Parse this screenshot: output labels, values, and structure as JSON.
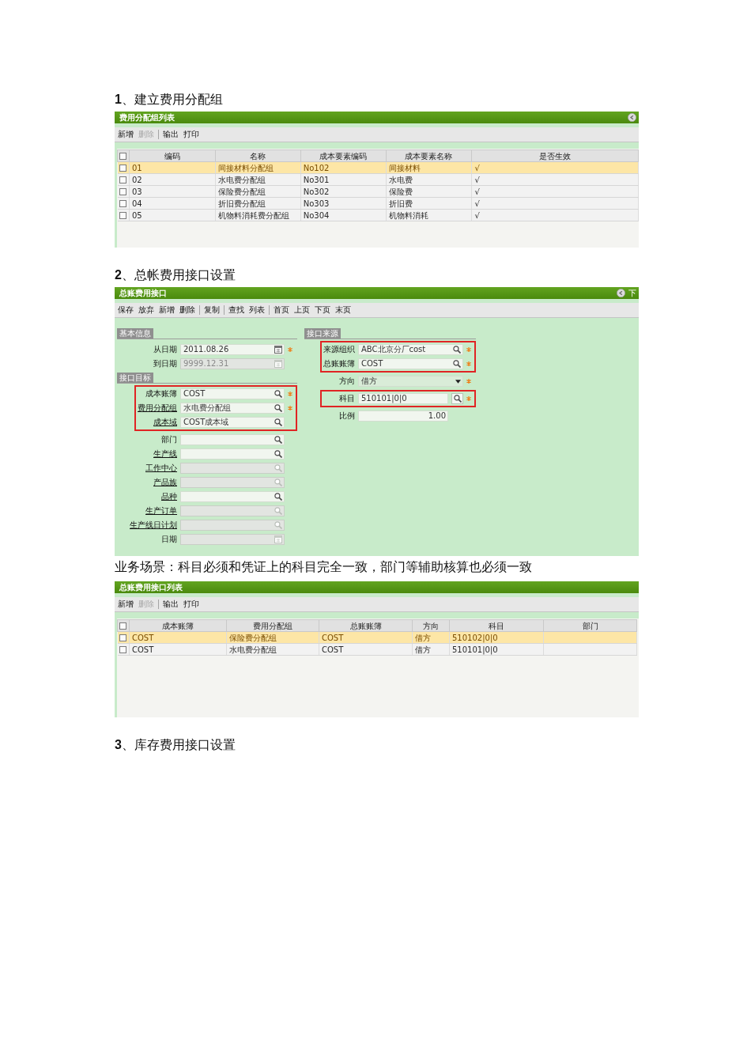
{
  "blocks": [
    {
      "kind": "heading",
      "text": "**1**、建立费用分配组"
    },
    {
      "kind": "list_panel",
      "title": "费用分配组列表",
      "collapsible": true,
      "toolbar": [
        [
          {
            "label": "新增",
            "disabled": false
          },
          {
            "label": "删除",
            "disabled": true
          }
        ],
        [
          {
            "label": "输出",
            "disabled": false
          },
          {
            "label": "打印",
            "disabled": false
          }
        ]
      ],
      "table": {
        "all_checked": false,
        "columns": [
          "编码",
          "名称",
          "成本要素编码",
          "成本要素名称",
          "是否生效"
        ],
        "rows": [
          {
            "selected": true,
            "checked": false,
            "cells": [
              "01",
              "间接材料分配组",
              "No102",
              "间接材料",
              "√"
            ]
          },
          {
            "selected": false,
            "checked": false,
            "cells": [
              "02",
              "水电费分配组",
              "No301",
              "水电费",
              "√"
            ]
          },
          {
            "selected": false,
            "checked": false,
            "cells": [
              "03",
              "保险费分配组",
              "No302",
              "保险费",
              "√"
            ]
          },
          {
            "selected": false,
            "checked": false,
            "cells": [
              "04",
              "折旧费分配组",
              "No303",
              "折旧费",
              "√"
            ]
          },
          {
            "selected": false,
            "checked": false,
            "cells": [
              "05",
              "机物料消耗费分配组",
              "No304",
              "机物料消耗",
              "√"
            ]
          }
        ]
      }
    },
    {
      "kind": "heading",
      "text": "**2**、总帐费用接口设置"
    },
    {
      "kind": "form_panel",
      "title": "总账费用接口",
      "collapsible": true,
      "corner_label": "下",
      "toolbar": [
        [
          {
            "label": "保存",
            "disabled": false
          },
          {
            "label": "放弃",
            "disabled": false
          },
          {
            "label": "新增",
            "disabled": false
          },
          {
            "label": "删除",
            "disabled": false
          }
        ],
        [
          {
            "label": "复制",
            "disabled": false
          }
        ],
        [
          {
            "label": "查找",
            "disabled": false
          },
          {
            "label": "列表",
            "disabled": false
          }
        ],
        [
          {
            "label": "首页",
            "disabled": false
          },
          {
            "label": "上页",
            "disabled": false
          },
          {
            "label": "下页",
            "disabled": false
          },
          {
            "label": "末页",
            "disabled": false
          }
        ]
      ],
      "form": {
        "columns": [
          {
            "sections": [
              {
                "title": "基本信息",
                "groups": [
                  {
                    "highlighted": false,
                    "fields": [
                      {
                        "label": "从日期",
                        "value": "2011.08.26",
                        "kind": "calendar",
                        "required": true,
                        "disabled": false,
                        "link": false
                      },
                      {
                        "label": "到日期",
                        "value": "9999.12.31",
                        "kind": "calendar",
                        "required": false,
                        "disabled": true,
                        "link": false
                      }
                    ]
                  }
                ]
              },
              {
                "title": "接口目标",
                "groups": [
                  {
                    "highlighted": true,
                    "fields": [
                      {
                        "label": "成本账簿",
                        "value": "COST",
                        "kind": "search",
                        "required": true,
                        "disabled": false,
                        "link": false
                      },
                      {
                        "label": "费用分配组",
                        "value": "水电费分配组",
                        "kind": "search",
                        "required": true,
                        "disabled": false,
                        "link": true
                      },
                      {
                        "label": "成本域",
                        "value": "COST成本域",
                        "kind": "search",
                        "required": false,
                        "disabled": false,
                        "link": true
                      }
                    ]
                  },
                  {
                    "highlighted": false,
                    "fields": [
                      {
                        "label": "部门",
                        "kind": "search",
                        "required": false,
                        "disabled": false,
                        "link": false
                      },
                      {
                        "label": "生产线",
                        "kind": "search",
                        "required": false,
                        "disabled": false,
                        "link": true
                      },
                      {
                        "label": "工作中心",
                        "kind": "search",
                        "required": false,
                        "disabled": true,
                        "link": true
                      },
                      {
                        "label": "产品族",
                        "kind": "search",
                        "required": false,
                        "disabled": true,
                        "link": true
                      },
                      {
                        "label": "品种",
                        "kind": "search",
                        "required": false,
                        "disabled": false,
                        "link": true
                      },
                      {
                        "label": "生产订单",
                        "kind": "search",
                        "required": false,
                        "disabled": true,
                        "link": true
                      },
                      {
                        "label": "生产线日计划",
                        "kind": "search",
                        "required": false,
                        "disabled": true,
                        "link": true
                      },
                      {
                        "label": "日期",
                        "kind": "calendar",
                        "required": false,
                        "disabled": true,
                        "link": false
                      }
                    ]
                  }
                ]
              }
            ]
          },
          {
            "sections": [
              {
                "title": "接口来源",
                "groups": [
                  {
                    "highlighted": true,
                    "fields": [
                      {
                        "label": "来源组织",
                        "value": "ABC北京分厂cost",
                        "kind": "search",
                        "required": true,
                        "disabled": false,
                        "link": false
                      },
                      {
                        "label": "总账账簿",
                        "value": "COST",
                        "kind": "search",
                        "required": true,
                        "disabled": false,
                        "link": false
                      }
                    ]
                  },
                  {
                    "highlighted": false,
                    "fields": [
                      {
                        "label": "方向",
                        "value": "借方",
                        "kind": "select",
                        "required": true,
                        "disabled": false,
                        "link": false
                      }
                    ]
                  },
                  {
                    "highlighted": true,
                    "fields": [
                      {
                        "label": "科目",
                        "value": "510101|0|0",
                        "kind": "lookup",
                        "required": true,
                        "disabled": false,
                        "link": false
                      }
                    ]
                  },
                  {
                    "highlighted": false,
                    "fields": [
                      {
                        "label": "比例",
                        "value": "1.00",
                        "kind": "number",
                        "required": false,
                        "disabled": false,
                        "link": false
                      }
                    ]
                  }
                ]
              }
            ]
          }
        ]
      }
    },
    {
      "kind": "paragraph",
      "text": "业务场景：科目必须和凭证上的科目完全一致，部门等辅助核算也必须一致"
    },
    {
      "kind": "list_panel",
      "title": "总账费用接口列表",
      "collapsible": false,
      "toolbar": [
        [
          {
            "label": "新增",
            "disabled": false
          },
          {
            "label": "删除",
            "disabled": true
          }
        ],
        [
          {
            "label": "输出",
            "disabled": false
          },
          {
            "label": "打印",
            "disabled": false
          }
        ]
      ],
      "table": {
        "all_checked": false,
        "columns": [
          "成本账簿",
          "费用分配组",
          "总账账簿",
          "方向",
          "科目",
          "部门"
        ],
        "rows": [
          {
            "selected": true,
            "checked": false,
            "cells": [
              "COST",
              "保险费分配组",
              "COST",
              "借方",
              "510102|0|0"
            ]
          },
          {
            "selected": false,
            "checked": false,
            "cells": [
              "COST",
              "水电费分配组",
              "COST",
              "借方",
              "510101|0|0"
            ]
          }
        ]
      }
    },
    {
      "kind": "heading",
      "text": "**3**、库存费用接口设置"
    }
  ]
}
